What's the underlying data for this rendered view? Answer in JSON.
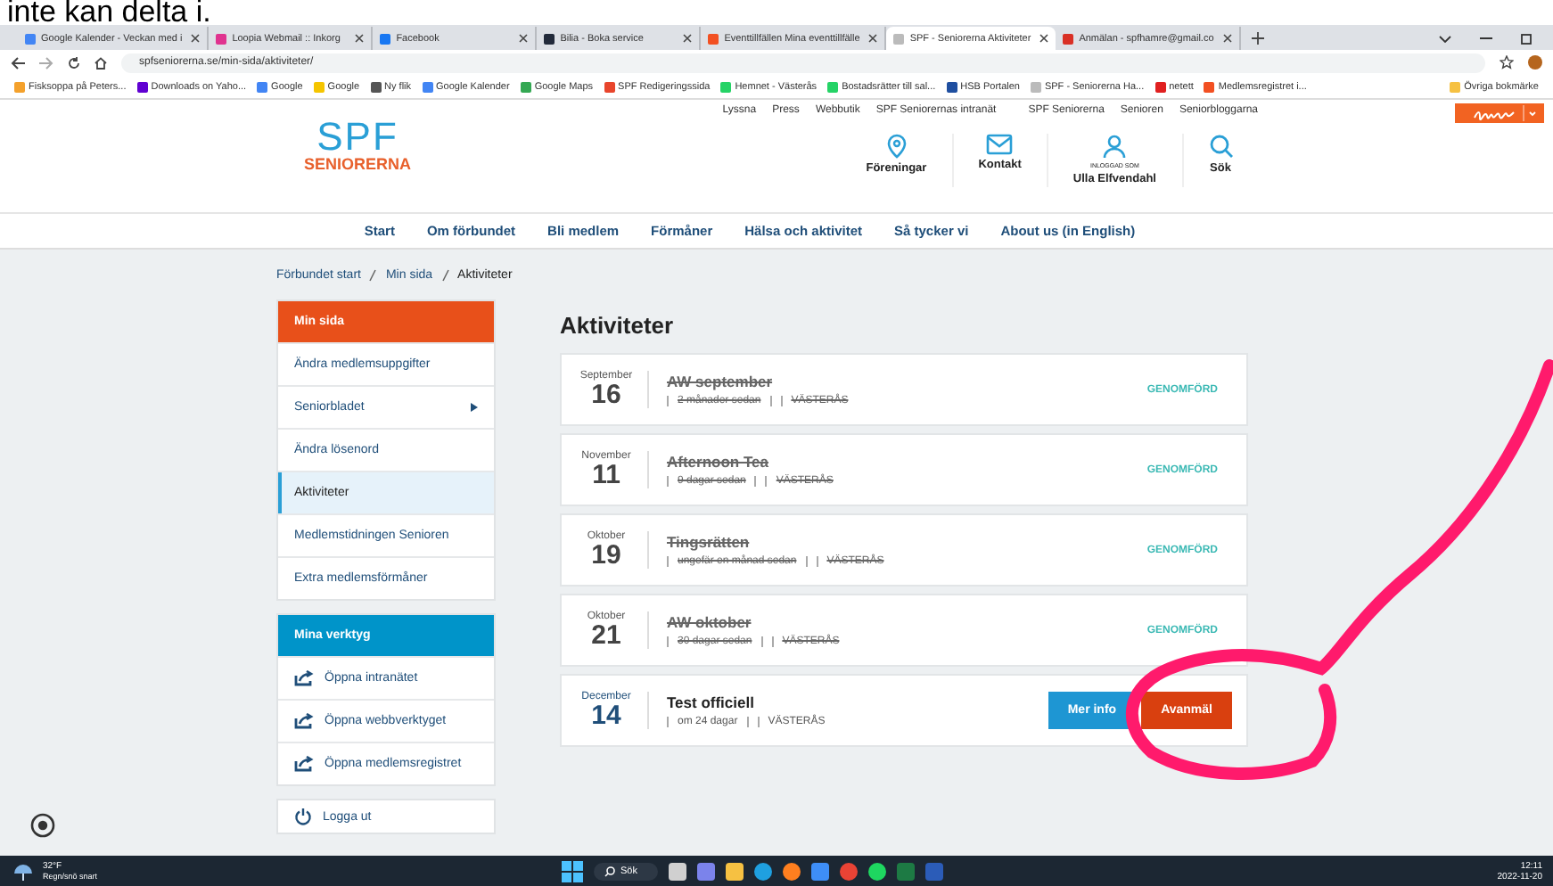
{
  "caption": "inte kan delta i.",
  "browser": {
    "tabs": [
      {
        "title": "Google Kalender - Veckan med i",
        "selected": false,
        "color": "#4285f4"
      },
      {
        "title": "Loopia Webmail :: Inkorg",
        "selected": false,
        "color": "#e0338f"
      },
      {
        "title": "Facebook",
        "selected": false,
        "color": "#1877f2"
      },
      {
        "title": "Bilia - Boka service",
        "selected": false,
        "color": "#222a3a"
      },
      {
        "title": "Eventtillfällen Mina eventtillfälle",
        "selected": false,
        "color": "#f25022"
      },
      {
        "title": "SPF - Seniorerna Aktiviteter",
        "selected": true,
        "color": "#bbbbbb"
      },
      {
        "title": "Anmälan - spfhamre@gmail.co",
        "selected": false,
        "color": "#d93025"
      }
    ],
    "address": "spfseniorerna.se/min-sida/aktiviteter/",
    "bookmarks": [
      {
        "label": "Fisksoppa på Peters...",
        "color": "#f4a12c"
      },
      {
        "label": "Downloads on Yaho...",
        "color": "#6001d2"
      },
      {
        "label": "Google",
        "color": "#4285f4"
      },
      {
        "label": "Google",
        "color": "#f5c500"
      },
      {
        "label": "Ny flik",
        "color": "#555555"
      },
      {
        "label": "Google Kalender",
        "color": "#4285f4"
      },
      {
        "label": "Google Maps",
        "color": "#34a853"
      },
      {
        "label": "SPF Redigeringssida",
        "color": "#e8452c"
      },
      {
        "label": "Hemnet - Västerås",
        "color": "#25d366"
      },
      {
        "label": "Bostadsrätter till sal...",
        "color": "#25d366"
      },
      {
        "label": "HSB Portalen",
        "color": "#1f4fa0"
      },
      {
        "label": "SPF - Seniorerna Ha...",
        "color": "#bbbbbb"
      },
      {
        "label": "netett",
        "color": "#e02020"
      },
      {
        "label": "Medlemsregistret i...",
        "color": "#f25022"
      }
    ],
    "other_bookmarks": "Övriga bokmärke"
  },
  "site": {
    "logo_top": "SPF",
    "logo_bottom": "SENIORERNA",
    "top_links": [
      "Lyssna",
      "Press",
      "Webbutik",
      "SPF Seniorernas intranät",
      "SPF Seniorerna",
      "Senioren",
      "Seniorbloggarna"
    ],
    "actions": [
      {
        "kind": "pin",
        "label": "Föreningar"
      },
      {
        "kind": "mail",
        "label": "Kontakt"
      },
      {
        "kind": "user",
        "label": "Ulla Elfvendahl",
        "sublabel": "INLOGGAD SOM"
      },
      {
        "kind": "search",
        "label": "Sök"
      }
    ],
    "nav": [
      "Start",
      "Om förbundet",
      "Bli medlem",
      "Förmåner",
      "Hälsa och aktivitet",
      "Så tycker vi",
      "About us (in English)"
    ],
    "breadcrumb": [
      "Förbundet start",
      "Min sida",
      "Aktiviteter"
    ],
    "sidebar": {
      "title": "Min sida",
      "items": [
        {
          "label": "Ändra medlemsuppgifter",
          "selected": false,
          "submenu": false
        },
        {
          "label": "Seniorbladet",
          "selected": false,
          "submenu": true
        },
        {
          "label": "Ändra lösenord",
          "selected": false,
          "submenu": false
        },
        {
          "label": "Aktiviteter",
          "selected": true,
          "submenu": false
        },
        {
          "label": "Medlemstidningen Senioren",
          "selected": false,
          "submenu": false
        },
        {
          "label": "Extra medlemsförmåner",
          "selected": false,
          "submenu": false
        }
      ]
    },
    "tools": {
      "title": "Mina verktyg",
      "items": [
        "Öppna intranätet",
        "Öppna webbverktyget",
        "Öppna medlemsregistret"
      ]
    },
    "logout": "Logga ut",
    "heading": "Aktiviteter",
    "activities": [
      {
        "month": "September",
        "day": "16",
        "title": "AW september",
        "when": "2 månader sedan",
        "place": "VÄSTERÅS",
        "completed": true,
        "status": "GENOMFÖRD"
      },
      {
        "month": "November",
        "day": "11",
        "title": "Afternoon Tea",
        "when": "9 dagar sedan",
        "place": "VÄSTERÅS",
        "completed": true,
        "status": "GENOMFÖRD"
      },
      {
        "month": "Oktober",
        "day": "19",
        "title": "Tingsrätten",
        "when": "ungefär en månad sedan",
        "place": "VÄSTERÅS",
        "completed": true,
        "status": "GENOMFÖRD"
      },
      {
        "month": "Oktober",
        "day": "21",
        "title": "AW oktober",
        "when": "30 dagar sedan",
        "place": "VÄSTERÅS",
        "completed": true,
        "status": "GENOMFÖRD"
      },
      {
        "month": "December",
        "day": "14",
        "title": "Test officiell",
        "when": "om 24 dagar",
        "place": "VÄSTERÅS",
        "completed": false,
        "buttons": [
          "Mer info",
          "Avanmäl"
        ]
      }
    ]
  },
  "taskbar": {
    "temperature": "32°F",
    "weather": "Regn/snö snart",
    "search": "Sök",
    "time": "12:11",
    "date": "2022-11-20"
  }
}
